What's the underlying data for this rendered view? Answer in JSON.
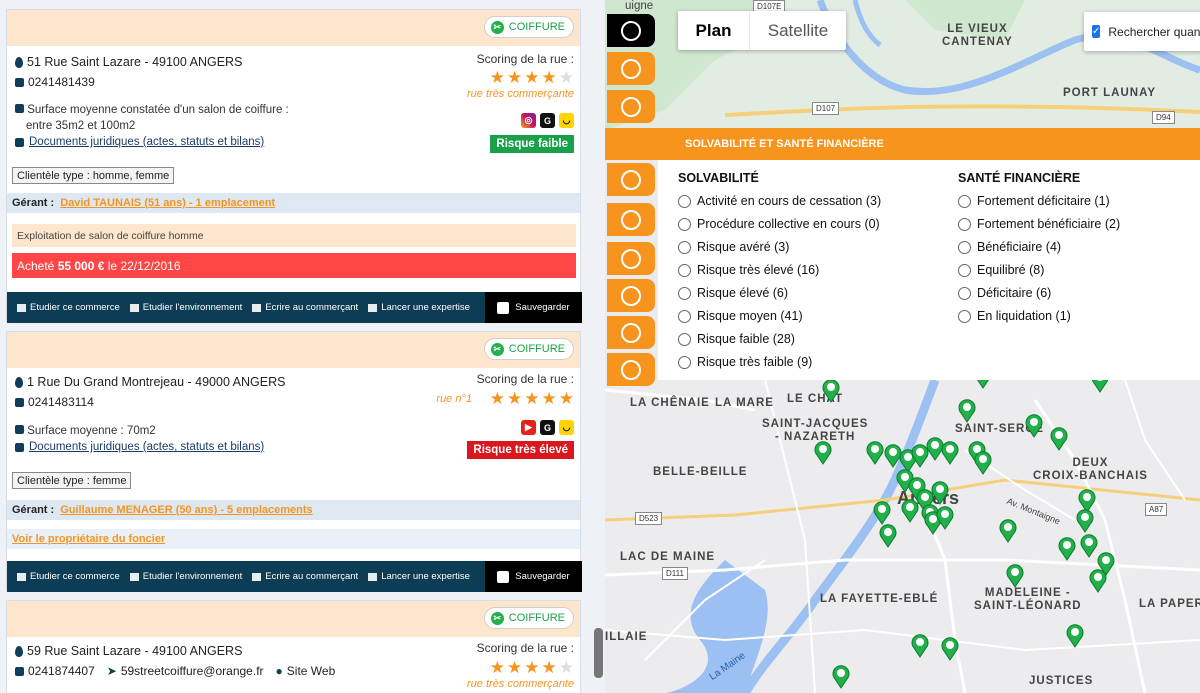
{
  "listings": [
    {
      "category": "COIFFURE",
      "address": "51 Rue Saint Lazare - 49100 ANGERS",
      "phone": "0241481439",
      "scoring_title": "Scoring de la rue :",
      "stars": 4,
      "street_label": "rue très commerçante",
      "surface_line1": "Surface moyenne constatée d'un salon de coiffure :",
      "surface_line2": "entre 35m2 et 100m2",
      "docs": "Documents juridiques (actes, statuts et bilans)",
      "risk": "Risque faible",
      "risk_color": "#1aa04a",
      "clientele": "Clientèle type : homme, femme",
      "manager_label": "Gérant :",
      "manager": "David TAUNAIS (51 ans) - 1 emplacement",
      "activity": "Exploitation de salon de coiffure homme",
      "bought_prefix": "Acheté",
      "bought_amount": "55 000 €",
      "bought_suffix": "le 22/12/2016"
    },
    {
      "category": "COIFFURE",
      "address": "1 Rue Du Grand Montrejeau - 49000 ANGERS",
      "phone": "0241483114",
      "scoring_title": "Scoring de la rue :",
      "stars": 5,
      "street_label": "rue n°1",
      "surface_line1": "Surface moyenne : 70m2",
      "docs": "Documents juridiques (actes, statuts et bilans)",
      "risk": "Risque très élevé",
      "risk_color": "#d9171f",
      "clientele": "Clientèle type : femme",
      "manager_label": "Gérant :",
      "manager": "Guillaume MENAGER (50 ans) - 5 emplacements",
      "foncier": "Voir le propriétaire du foncier"
    },
    {
      "category": "COIFFURE",
      "address": "59 Rue Saint Lazare - 49100 ANGERS",
      "phone": "0241874407",
      "email": "59streetcoiffure@orange.fr",
      "website": "Site Web",
      "scoring_title": "Scoring de la rue :",
      "stars": 4,
      "street_label": "rue très commerçante"
    }
  ],
  "actions": {
    "study": "Etudier ce commerce",
    "env": "Etudier l'environnement",
    "write": "Ecrire au commerçant",
    "expertise": "Lancer une expertise",
    "save": "Sauvegarder"
  },
  "map": {
    "type_plan": "Plan",
    "type_satellite": "Satellite",
    "search_here": "Rechercher quand je déplace la carte",
    "filter_header": "SOLVABILITÉ ET SANTÉ FINANCIÈRE",
    "solvabilite_title": "SOLVABILITÉ",
    "solvabilite_options": [
      "Activité en cours de cessation (3)",
      "Procédure collective en cours (0)",
      "Risque avéré (3)",
      "Risque très élevé (16)",
      "Risque élevé (6)",
      "Risque moyen (41)",
      "Risque faible (28)",
      "Risque très faible (9)"
    ],
    "sante_title": "SANTÉ FINANCIÈRE",
    "sante_options": [
      "Fortement déficitaire (1)",
      "Fortement bénéficiaire (2)",
      "Bénéficiaire (4)",
      "Equilibré (8)",
      "Déficitaire (6)",
      "En liquidation (1)"
    ],
    "places": {
      "vieux_cantenay_1": "LE VIEUX",
      "vieux_cantenay_2": "CANTENAY",
      "port_launay": "PORT LAUNAY",
      "chenaie": "LA CHÊNAIE",
      "la_mare": "LA MARE",
      "le_chat": "LE CHAT",
      "sj_nazareth_1": "SAINT-JACQUES",
      "sj_nazareth_2": "- NAZARETH",
      "saint_serge": "SAINT-SERGE",
      "belle_beille": "BELLE-BEILLE",
      "deux_croix_1": "DEUX",
      "deux_croix_2": "CROIX-BANCHAIS",
      "angers": "Angers",
      "lac_maine": "LAC DE MAINE",
      "fayette": "LA FAYETTE-EBLÉ",
      "madeleine_1": "MADELEINE -",
      "madeleine_2": "SAINT-LÉONARD",
      "la_paper": "LA PAPER",
      "illaie": "ILLAIE",
      "justices": "JUSTICES",
      "av_montaigne": "Av. Montaigne",
      "la_maine": "La Maine",
      "top_partial": "uigne"
    },
    "roads": [
      "D107E",
      "D107",
      "D94",
      "D523",
      "D111",
      "A87"
    ]
  }
}
